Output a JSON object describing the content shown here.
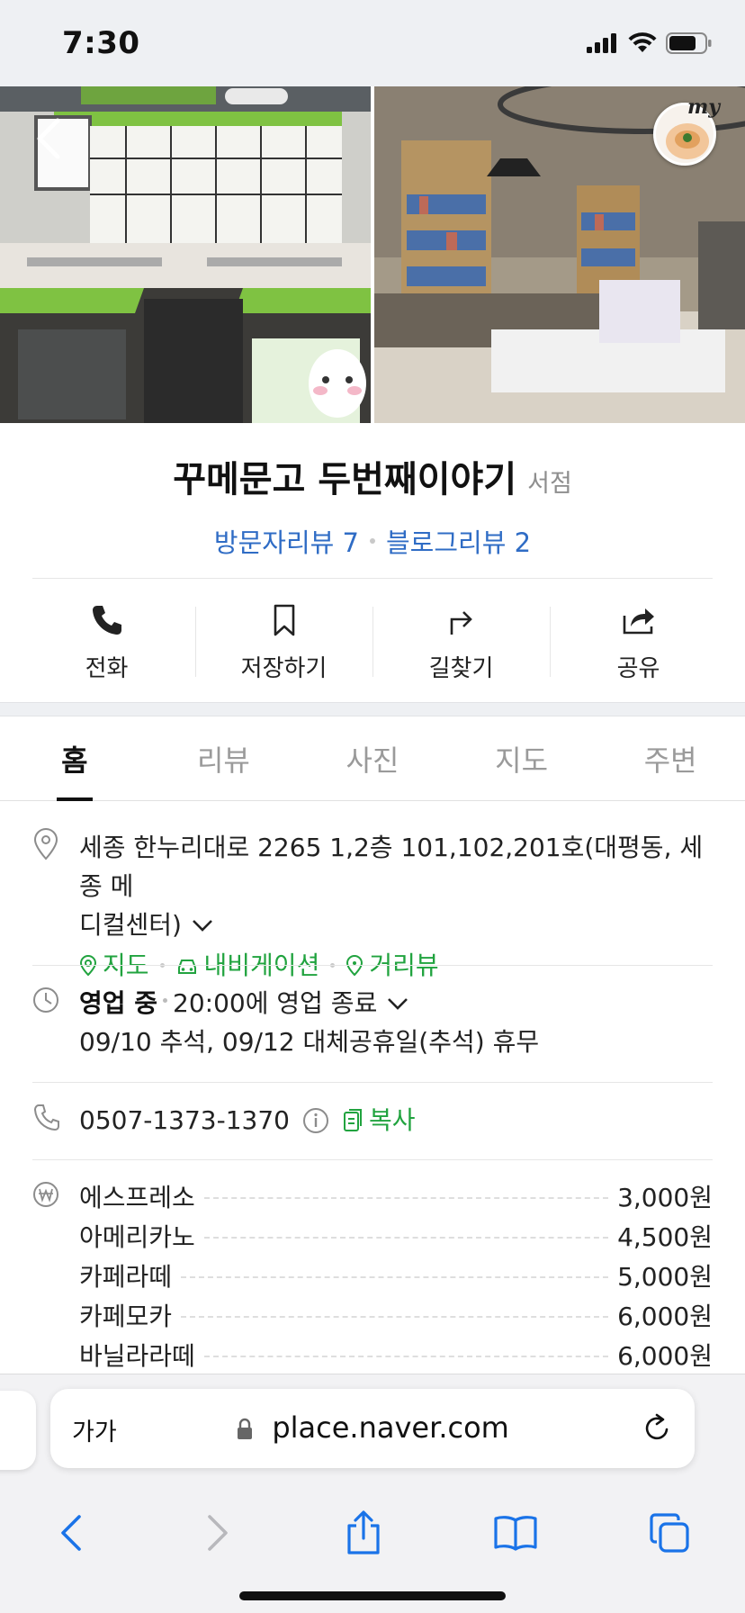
{
  "status_bar": {
    "time": "7:30"
  },
  "hero": {
    "badge_text": "my"
  },
  "place": {
    "name": "꾸메문고 두번째이야기",
    "category": "서점",
    "visitor_reviews": "방문자리뷰 7",
    "blog_reviews": "블로그리뷰 2"
  },
  "actions": [
    {
      "label": "전화",
      "icon": "phone-icon"
    },
    {
      "label": "저장하기",
      "icon": "bookmark-icon"
    },
    {
      "label": "길찾기",
      "icon": "directions-icon"
    },
    {
      "label": "공유",
      "icon": "share-icon"
    }
  ],
  "tabs": [
    {
      "label": "홈",
      "active": true
    },
    {
      "label": "리뷰"
    },
    {
      "label": "사진"
    },
    {
      "label": "지도"
    },
    {
      "label": "주변"
    }
  ],
  "address": {
    "text": "세종 한누리대로 2265 1,2층 101,102,201호(대평동, 세종 메디컬센터)",
    "line1": "세종 한누리대로 2265 1,2층 101,102,201호(대평동, 세종 메",
    "line2": "디컬센터)",
    "links": {
      "map": "지도",
      "navigation": "내비게이션",
      "street_view": "거리뷰"
    }
  },
  "hours": {
    "status": "영업 중",
    "closing": "20:00에 영업 종료",
    "holiday_note": "09/10 추석, 09/12 대체공휴일(추석) 휴무"
  },
  "phone": {
    "number": "0507-1373-1370",
    "copy_label": "복사"
  },
  "menu": [
    {
      "name": "에스프레소",
      "price": "3,000원"
    },
    {
      "name": "아메리카노",
      "price": "4,500원"
    },
    {
      "name": "카페라떼",
      "price": "5,000원"
    },
    {
      "name": "카페모카",
      "price": "6,000원"
    },
    {
      "name": "바닐라라떼",
      "price": "6,000원"
    }
  ],
  "browser": {
    "text_size_label": "가가",
    "url": "place.naver.com"
  },
  "colors": {
    "link_blue": "#2f6cc5",
    "green": "#21a33f",
    "ios_blue": "#1a73e8"
  }
}
